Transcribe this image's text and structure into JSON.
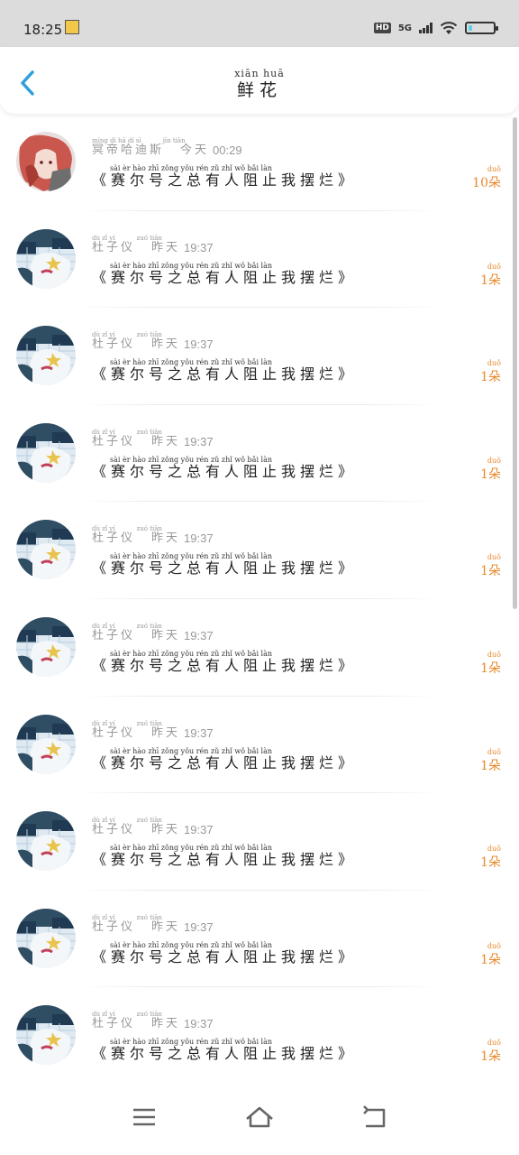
{
  "status_bar": {
    "time": "18:25",
    "network": "5G",
    "hd_label": "HD"
  },
  "header": {
    "title_pinyin": "xiān huā",
    "title": "鲜花"
  },
  "colors": {
    "accent_blue": "#2e9fdc",
    "count_orange": "#e8892c"
  },
  "items": [
    {
      "name_pinyin": "míng dì hā dí sī",
      "name": "冥帝哈迪斯",
      "day_pinyin": "jīn tiān",
      "day": "今天",
      "time": "00:29",
      "msg_pinyin": "sài  èr  hào  zhī zǒng yǒu rén  zǔ  zhǐ  wǒ  bǎi  làn",
      "msg": "《赛尔号之总有人阻止我摆烂》",
      "count": "10",
      "unit_pinyin": "duǒ",
      "unit": "朵",
      "avatar": "anime-red-hair"
    },
    {
      "name_pinyin": "dù  zǐ  yí",
      "name": "杜子仪",
      "day_pinyin": "zuó tiān",
      "day": "昨天",
      "time": "19:37",
      "msg_pinyin": "sài  èr  hào  zhī zǒng yǒu rén  zǔ  zhǐ  wǒ  bǎi  làn",
      "msg": "《赛尔号之总有人阻止我摆烂》",
      "count": "1",
      "unit_pinyin": "duǒ",
      "unit": "朵",
      "avatar": "anime-blue"
    },
    {
      "name_pinyin": "dù  zǐ  yí",
      "name": "杜子仪",
      "day_pinyin": "zuó tiān",
      "day": "昨天",
      "time": "19:37",
      "msg_pinyin": "sài  èr  hào  zhī zǒng yǒu rén  zǔ  zhǐ  wǒ  bǎi  làn",
      "msg": "《赛尔号之总有人阻止我摆烂》",
      "count": "1",
      "unit_pinyin": "duǒ",
      "unit": "朵",
      "avatar": "anime-blue"
    },
    {
      "name_pinyin": "dù  zǐ  yí",
      "name": "杜子仪",
      "day_pinyin": "zuó tiān",
      "day": "昨天",
      "time": "19:37",
      "msg_pinyin": "sài  èr  hào  zhī zǒng yǒu rén  zǔ  zhǐ  wǒ  bǎi  làn",
      "msg": "《赛尔号之总有人阻止我摆烂》",
      "count": "1",
      "unit_pinyin": "duǒ",
      "unit": "朵",
      "avatar": "anime-blue"
    },
    {
      "name_pinyin": "dù  zǐ  yí",
      "name": "杜子仪",
      "day_pinyin": "zuó tiān",
      "day": "昨天",
      "time": "19:37",
      "msg_pinyin": "sài  èr  hào  zhī zǒng yǒu rén  zǔ  zhǐ  wǒ  bǎi  làn",
      "msg": "《赛尔号之总有人阻止我摆烂》",
      "count": "1",
      "unit_pinyin": "duǒ",
      "unit": "朵",
      "avatar": "anime-blue"
    },
    {
      "name_pinyin": "dù  zǐ  yí",
      "name": "杜子仪",
      "day_pinyin": "zuó tiān",
      "day": "昨天",
      "time": "19:37",
      "msg_pinyin": "sài  èr  hào  zhī zǒng yǒu rén  zǔ  zhǐ  wǒ  bǎi  làn",
      "msg": "《赛尔号之总有人阻止我摆烂》",
      "count": "1",
      "unit_pinyin": "duǒ",
      "unit": "朵",
      "avatar": "anime-blue"
    },
    {
      "name_pinyin": "dù  zǐ  yí",
      "name": "杜子仪",
      "day_pinyin": "zuó tiān",
      "day": "昨天",
      "time": "19:37",
      "msg_pinyin": "sài  èr  hào  zhī zǒng yǒu rén  zǔ  zhǐ  wǒ  bǎi  làn",
      "msg": "《赛尔号之总有人阻止我摆烂》",
      "count": "1",
      "unit_pinyin": "duǒ",
      "unit": "朵",
      "avatar": "anime-blue"
    },
    {
      "name_pinyin": "dù  zǐ  yí",
      "name": "杜子仪",
      "day_pinyin": "zuó tiān",
      "day": "昨天",
      "time": "19:37",
      "msg_pinyin": "sài  èr  hào  zhī zǒng yǒu rén  zǔ  zhǐ  wǒ  bǎi  làn",
      "msg": "《赛尔号之总有人阻止我摆烂》",
      "count": "1",
      "unit_pinyin": "duǒ",
      "unit": "朵",
      "avatar": "anime-blue"
    },
    {
      "name_pinyin": "dù  zǐ  yí",
      "name": "杜子仪",
      "day_pinyin": "zuó tiān",
      "day": "昨天",
      "time": "19:37",
      "msg_pinyin": "sài  èr  hào  zhī zǒng yǒu rén  zǔ  zhǐ  wǒ  bǎi  làn",
      "msg": "《赛尔号之总有人阻止我摆烂》",
      "count": "1",
      "unit_pinyin": "duǒ",
      "unit": "朵",
      "avatar": "anime-blue"
    },
    {
      "name_pinyin": "dù  zǐ  yí",
      "name": "杜子仪",
      "day_pinyin": "zuó tiān",
      "day": "昨天",
      "time": "19:37",
      "msg_pinyin": "sài  èr  hào  zhī zǒng yǒu rén  zǔ  zhǐ  wǒ  bǎi  làn",
      "msg": "《赛尔号之总有人阻止我摆烂》",
      "count": "1",
      "unit_pinyin": "duǒ",
      "unit": "朵",
      "avatar": "anime-blue"
    }
  ],
  "nav": {
    "menu_icon": "menu-icon",
    "home_icon": "home-icon",
    "back_icon": "back-nav-icon"
  }
}
